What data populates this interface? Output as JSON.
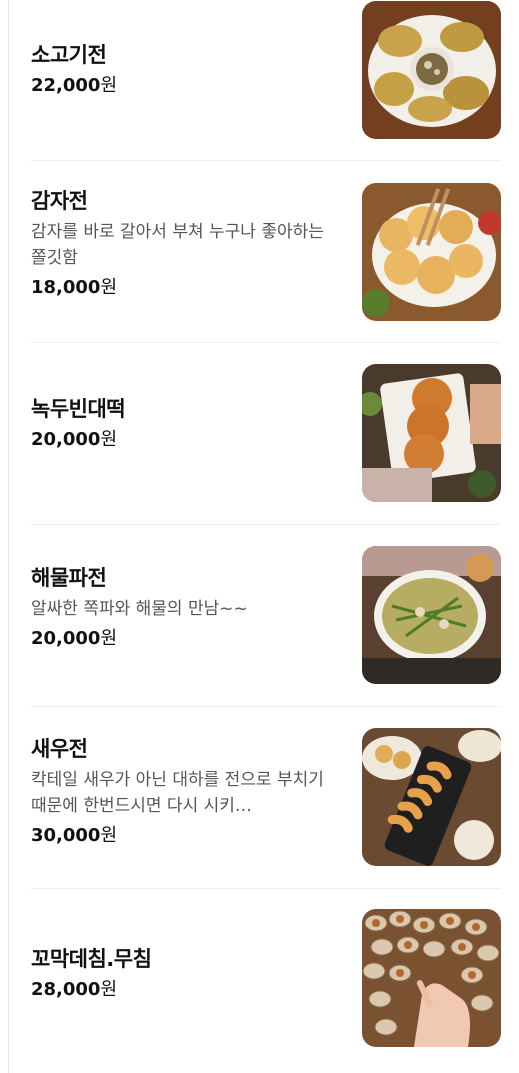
{
  "menu": {
    "items": [
      {
        "name": "소고기전",
        "description": "",
        "price": "22,000",
        "currency": "원",
        "image": "beef-jeon-photo"
      },
      {
        "name": "감자전",
        "description": "감자를 바로 갈아서 부쳐 누구나 좋아하는 쫄깃함",
        "price": "18,000",
        "currency": "원",
        "image": "potato-pancake-photo"
      },
      {
        "name": "녹두빈대떡",
        "description": "",
        "price": "20,000",
        "currency": "원",
        "image": "mungbean-pancake-photo"
      },
      {
        "name": "해물파전",
        "description": "알싸한 쪽파와 해물의 만남~~",
        "price": "20,000",
        "currency": "원",
        "image": "seafood-pancake-photo"
      },
      {
        "name": "새우전",
        "description": "칵테일 새우가 아닌 대하를 전으로 부치기 때문에 한번드시면 다시 시키…",
        "price": "30,000",
        "currency": "원",
        "image": "shrimp-jeon-photo"
      },
      {
        "name": "꼬막데침.무침",
        "description": "",
        "price": "28,000",
        "currency": "원",
        "image": "cockles-photo"
      }
    ]
  }
}
